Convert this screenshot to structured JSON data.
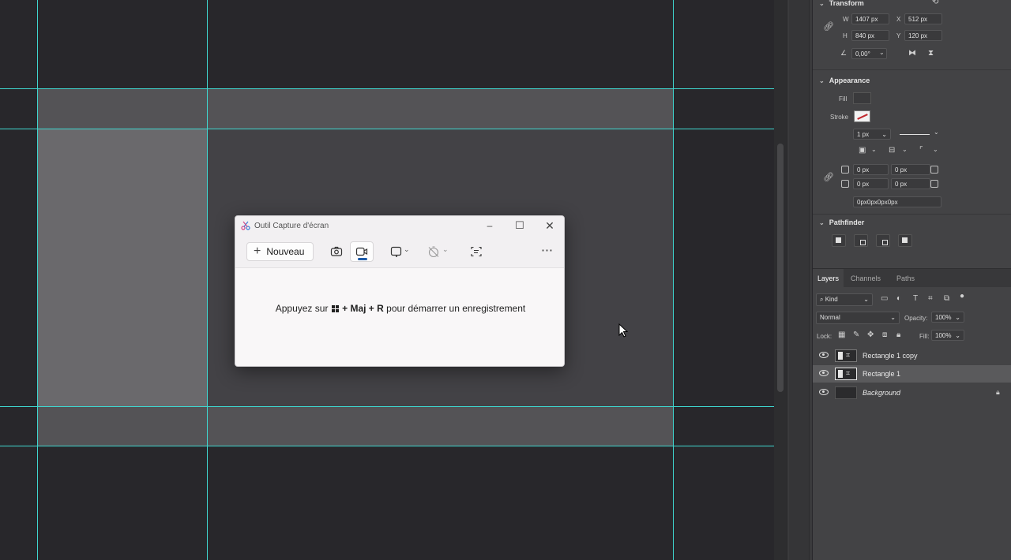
{
  "properties": {
    "transform": {
      "title": "Transform",
      "w_label": "W",
      "w_value": "1407 px",
      "x_label": "X",
      "x_value": "512 px",
      "h_label": "H",
      "h_value": "840 px",
      "y_label": "Y",
      "y_value": "120 px",
      "angle_value": "0,00°"
    },
    "appearance": {
      "title": "Appearance",
      "fill_label": "Fill",
      "stroke_label": "Stroke",
      "stroke_width": "1 px",
      "corner_tl": "0 px",
      "corner_tr": "0 px",
      "corner_bl": "0 px",
      "corner_br": "0 px",
      "corner_summary": "0px0px0px0px"
    },
    "pathfinder": {
      "title": "Pathfinder"
    }
  },
  "layers": {
    "tabs": [
      "Layers",
      "Channels",
      "Paths"
    ],
    "filter_kind": "Kind",
    "blend_mode": "Normal",
    "opacity_label": "Opacity:",
    "opacity_value": "100%",
    "lock_label": "Lock:",
    "fill_label": "Fill:",
    "fill_value": "100%",
    "items": [
      {
        "name": "Rectangle 1 copy",
        "selected": false
      },
      {
        "name": "Rectangle 1",
        "selected": true
      },
      {
        "name": "Background",
        "selected": false,
        "locked": true
      }
    ]
  },
  "snipping_tool": {
    "title": "Outil Capture d'écran",
    "new_label": "Nouveau",
    "hint_before": "Appuyez sur",
    "hint_keys": "+ Maj + R",
    "hint_after": "pour démarrer un enregistrement",
    "icons": [
      "camera-icon",
      "video-icon",
      "rectangle-mode-icon",
      "timer-off-icon",
      "text-actions-icon",
      "more-icon"
    ]
  },
  "colors": {
    "canvas": "#28272b",
    "guide": "#3fd6cf",
    "band": "#545356",
    "column": "#6a696c",
    "rect_inner": "#434246",
    "panel": "#434345",
    "accent": "#1d5aa8"
  }
}
